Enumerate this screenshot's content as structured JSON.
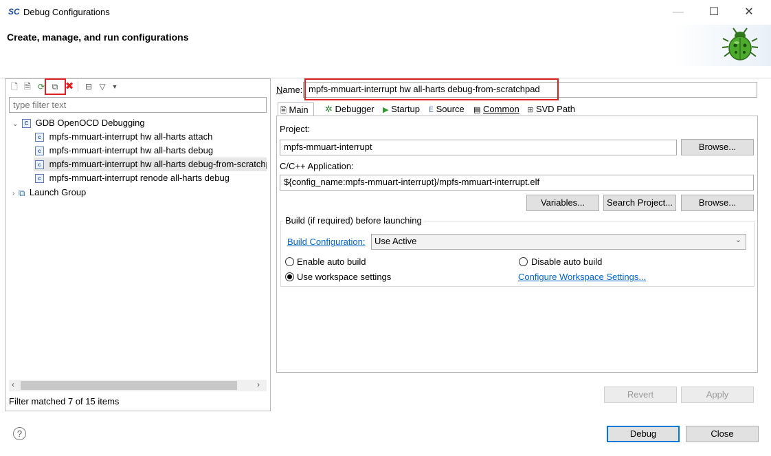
{
  "window": {
    "logo": "SC",
    "title": "Debug Configurations",
    "minimize": "—",
    "maximize": "☐",
    "close": "✕"
  },
  "header": {
    "title": "Create, manage, and run configurations"
  },
  "left": {
    "filter_placeholder": "type filter text",
    "tree": [
      {
        "label": "GDB OpenOCD Debugging"
      },
      {
        "label": "mpfs-mmuart-interrupt hw all-harts attach"
      },
      {
        "label": "mpfs-mmuart-interrupt hw all-harts debug"
      },
      {
        "label": "mpfs-mmuart-interrupt hw all-harts debug-from-scratchpad"
      },
      {
        "label": "mpfs-mmuart-interrupt renode all-harts debug"
      },
      {
        "label": "Launch Group"
      }
    ],
    "status": "Filter matched 7 of 15 items"
  },
  "right": {
    "name_label": "Name:",
    "name_value": "mpfs-mmuart-interrupt hw all-harts debug-from-scratchpad",
    "tabs": [
      "Main",
      "Debugger",
      "Startup",
      "Source",
      "Common",
      "SVD Path"
    ],
    "project_label": "Project:",
    "project_value": "mpfs-mmuart-interrupt",
    "browse_label": "Browse...",
    "app_label": "C/C++ Application:",
    "app_value": "${config_name:mpfs-mmuart-interrupt}/mpfs-mmuart-interrupt.elf",
    "variables_label": "Variables...",
    "search_project_label": "Search Project...",
    "build_group": "Build (if required) before launching",
    "build_config_link": "Build Configuration:",
    "build_config_value": "Use Active",
    "enable_auto_build": "Enable auto build",
    "disable_auto_build": "Disable auto build",
    "use_workspace": "Use workspace settings",
    "configure_workspace": "Configure Workspace Settings...",
    "revert": "Revert",
    "apply": "Apply"
  },
  "footer": {
    "debug": "Debug",
    "close": "Close",
    "help": "?"
  }
}
